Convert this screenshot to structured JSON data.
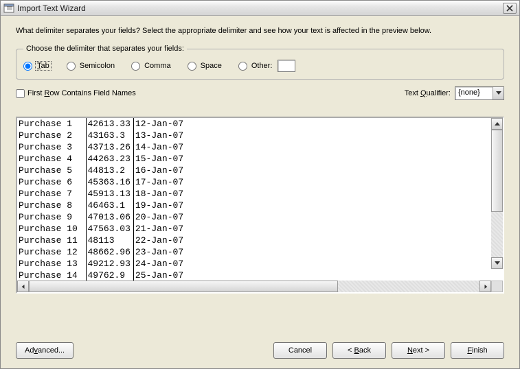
{
  "window": {
    "title": "Import Text Wizard"
  },
  "prompt": "What delimiter separates your fields? Select the appropriate delimiter and see how your text is affected in the preview below.",
  "delimiter_group": {
    "legend": "Choose the delimiter that separates your fields:",
    "options": {
      "tab": "Tab",
      "semicolon": "Semicolon",
      "comma": "Comma",
      "space": "Space",
      "other": "Other:"
    },
    "selected": "tab",
    "other_value": ""
  },
  "first_row_checkbox": {
    "label": "First Row Contains Field Names",
    "checked": false
  },
  "text_qualifier": {
    "label": "Text Qualifier:",
    "value": "{none}"
  },
  "preview_rows": [
    {
      "c1": "Purchase 1",
      "c2": "42613.33",
      "c3": "12-Jan-07"
    },
    {
      "c1": "Purchase 2",
      "c2": "43163.3",
      "c3": "13-Jan-07"
    },
    {
      "c1": "Purchase 3",
      "c2": "43713.26",
      "c3": "14-Jan-07"
    },
    {
      "c1": "Purchase 4",
      "c2": "44263.23",
      "c3": "15-Jan-07"
    },
    {
      "c1": "Purchase 5",
      "c2": "44813.2",
      "c3": "16-Jan-07"
    },
    {
      "c1": "Purchase 6",
      "c2": "45363.16",
      "c3": "17-Jan-07"
    },
    {
      "c1": "Purchase 7",
      "c2": "45913.13",
      "c3": "18-Jan-07"
    },
    {
      "c1": "Purchase 8",
      "c2": "46463.1",
      "c3": "19-Jan-07"
    },
    {
      "c1": "Purchase 9",
      "c2": "47013.06",
      "c3": "20-Jan-07"
    },
    {
      "c1": "Purchase 10",
      "c2": "47563.03",
      "c3": "21-Jan-07"
    },
    {
      "c1": "Purchase 11",
      "c2": "48113",
      "c3": "22-Jan-07"
    },
    {
      "c1": "Purchase 12",
      "c2": "48662.96",
      "c3": "23-Jan-07"
    },
    {
      "c1": "Purchase 13",
      "c2": "49212.93",
      "c3": "24-Jan-07"
    },
    {
      "c1": "Purchase 14",
      "c2": "49762.9",
      "c3": "25-Jan-07"
    }
  ],
  "buttons": {
    "advanced": "Advanced...",
    "cancel": "Cancel",
    "back": "< Back",
    "next": "Next >",
    "finish": "Finish"
  }
}
